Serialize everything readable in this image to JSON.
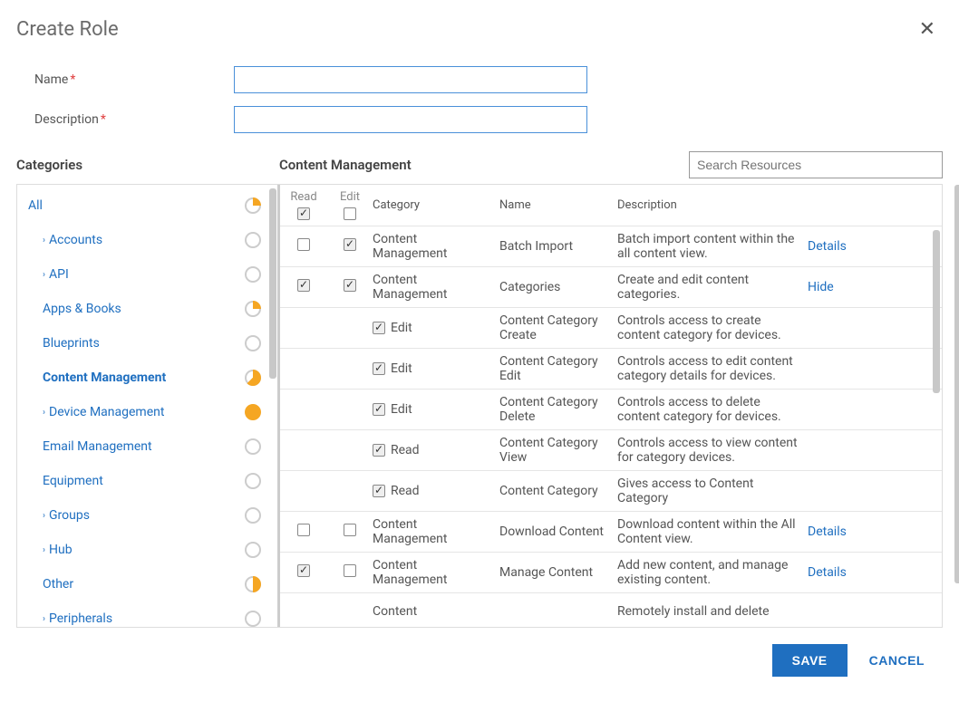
{
  "dialog": {
    "title": "Create Role",
    "close": "✕"
  },
  "form": {
    "name_label": "Name",
    "desc_label": "Description",
    "required_mark": "*"
  },
  "sections": {
    "categories_title": "Categories",
    "content_title": "Content Management"
  },
  "search": {
    "placeholder": "Search Resources"
  },
  "sidebar": {
    "items": [
      {
        "label": "All",
        "expandable": false,
        "pie": "q25",
        "all": true
      },
      {
        "label": "Accounts",
        "expandable": true,
        "pie": "empty"
      },
      {
        "label": "API",
        "expandable": true,
        "pie": "empty"
      },
      {
        "label": "Apps & Books",
        "expandable": false,
        "pie": "q25"
      },
      {
        "label": "Blueprints",
        "expandable": false,
        "pie": "empty"
      },
      {
        "label": "Content Management",
        "expandable": false,
        "pie": "q62",
        "active": true
      },
      {
        "label": "Device Management",
        "expandable": true,
        "pie": "full"
      },
      {
        "label": "Email Management",
        "expandable": false,
        "pie": "empty"
      },
      {
        "label": "Equipment",
        "expandable": false,
        "pie": "empty"
      },
      {
        "label": "Groups",
        "expandable": true,
        "pie": "empty"
      },
      {
        "label": "Hub",
        "expandable": true,
        "pie": "empty"
      },
      {
        "label": "Other",
        "expandable": false,
        "pie": "q50"
      },
      {
        "label": "Peripherals",
        "expandable": true,
        "pie": "empty"
      }
    ]
  },
  "table": {
    "head": {
      "read": "Read",
      "edit": "Edit",
      "category": "Category",
      "name": "Name",
      "description": "Description"
    },
    "rows": [
      {
        "read": false,
        "edit": true,
        "category": "Content Management",
        "name": "Batch Import",
        "description": "Batch import content within the all content view.",
        "link": "Details"
      },
      {
        "read": true,
        "edit": true,
        "category": "Content Management",
        "name": "Categories",
        "description": "Create and edit content categories.",
        "link": "Hide"
      },
      {
        "sub": true,
        "subtype": "Edit",
        "name": "Content Category Create",
        "description": "Controls access to create content category for devices."
      },
      {
        "sub": true,
        "subtype": "Edit",
        "name": "Content Category Edit",
        "description": "Controls access to edit content category details for devices."
      },
      {
        "sub": true,
        "subtype": "Edit",
        "name": "Content Category Delete",
        "description": "Controls access to delete content category for devices."
      },
      {
        "sub": true,
        "subtype": "Read",
        "name": "Content Category View",
        "description": "Controls access to view content for category devices."
      },
      {
        "sub": true,
        "subtype": "Read",
        "name": "Content Category",
        "description": "Gives access to Content Category"
      },
      {
        "read": false,
        "edit": false,
        "category": "Content Management",
        "name": "Download Content",
        "description": "Download content within the All Content view.",
        "link": "Details"
      },
      {
        "read": true,
        "edit": false,
        "category": "Content Management",
        "name": "Manage Content",
        "description": "Add new content, and manage existing content.",
        "link": "Details"
      },
      {
        "truncated": true,
        "category": "Content",
        "description": "Remotely install and delete"
      }
    ]
  },
  "footer": {
    "save": "SAVE",
    "cancel": "CANCEL"
  }
}
